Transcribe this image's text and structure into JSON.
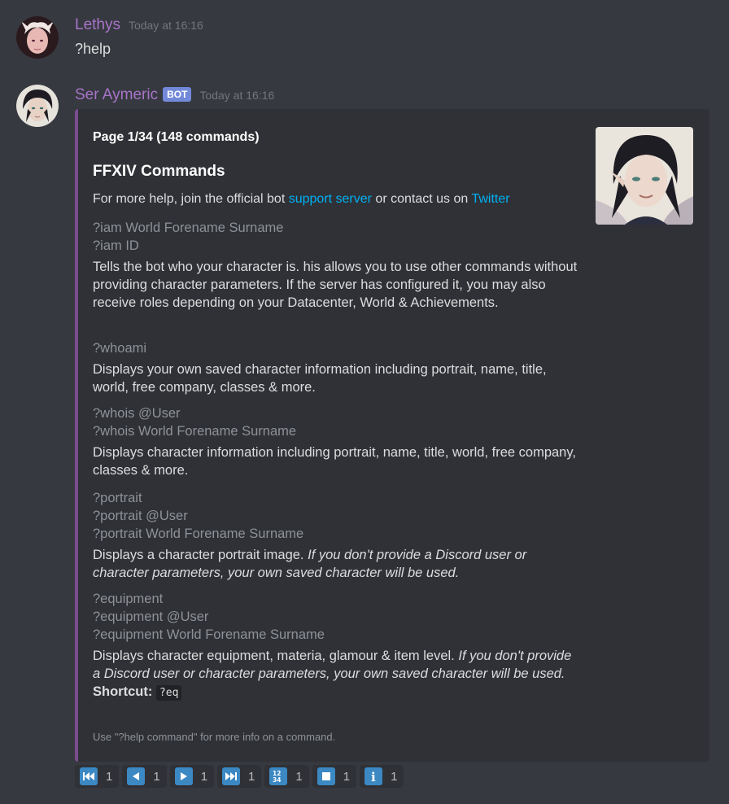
{
  "messages": [
    {
      "username": "Lethys",
      "username_color": "#a874c9",
      "timestamp": "Today at 16:16",
      "text": "?help"
    },
    {
      "username": "Ser Aymeric",
      "username_color": "#a874c9",
      "bot_tag": "BOT",
      "timestamp": "Today at 16:16"
    }
  ],
  "embed": {
    "accent_color": "#7a4d8f",
    "author": "Page 1/34 (148 commands)",
    "title": "FFXIV Commands",
    "description": {
      "prefix": "For more help, join the official bot ",
      "link1": "support server",
      "middle": " or contact us on ",
      "link2": "Twitter"
    },
    "fields": [
      {
        "commands": [
          "?iam World Forename Surname",
          "?iam ID"
        ],
        "description": "Tells the bot who your character is. his allows you to use other commands without providing character parameters. If the server has configured it, you may also receive roles depending on your Datacenter, World & Achievements."
      },
      {
        "commands": [
          "?whoami"
        ],
        "description": "Displays your own saved character information including portrait, name, title, world, free company, classes & more."
      },
      {
        "commands": [
          "?whois @User",
          "?whois World Forename Surname"
        ],
        "description": "Displays character information including portrait, name, title, world, free company, classes & more."
      },
      {
        "commands": [
          "?portrait",
          "?portrait @User",
          "?portrait World Forename Surname"
        ],
        "description": "Displays a character portrait image. ",
        "note": "If you don't provide a Discord user or character parameters, your own saved character will be used."
      },
      {
        "commands": [
          "?equipment",
          "?equipment @User",
          "?equipment World Forename Surname"
        ],
        "description": "Displays character equipment, materia, glamour & item level. ",
        "note": "If you don't provide a Discord user or character parameters, your own saved character will be used.",
        "shortcut_label": "Shortcut:",
        "shortcut_code": "?eq"
      }
    ],
    "footer": "Use \"?help command\" for more info on a command."
  },
  "reactions": [
    {
      "icon": "first-page-icon",
      "count": "1"
    },
    {
      "icon": "previous-page-icon",
      "count": "1"
    },
    {
      "icon": "next-page-icon",
      "count": "1"
    },
    {
      "icon": "last-page-icon",
      "count": "1"
    },
    {
      "icon": "page-number-icon",
      "count": "1",
      "glyph": "1234"
    },
    {
      "icon": "stop-icon",
      "count": "1"
    },
    {
      "icon": "info-icon",
      "count": "1",
      "glyph": "i"
    }
  ]
}
